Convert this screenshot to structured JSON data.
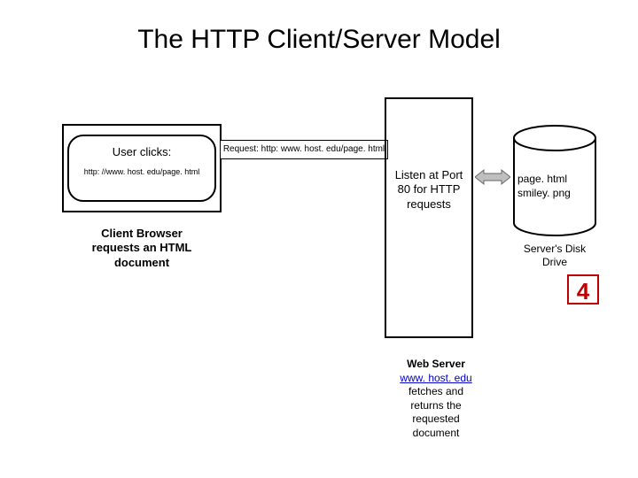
{
  "title": "The HTTP Client/Server Model",
  "client": {
    "label_line1": "User clicks:",
    "label_line2": "http: //www. host. edu/page. html",
    "caption": "Client Browser requests an HTML document"
  },
  "request": {
    "label": "Request: http: www. host. edu/page. html"
  },
  "server": {
    "inside_text": "Listen at Port 80 for HTTP requests",
    "caption_bold": "Web Server",
    "caption_link": "www. host. edu",
    "caption_rest": "fetches and returns the requested document"
  },
  "disk": {
    "files": [
      "page. html",
      "smiley. png"
    ],
    "caption": "Server's Disk Drive"
  },
  "step": "4",
  "colors": {
    "accent_red": "#c00000",
    "link_blue": "#0000cc"
  }
}
